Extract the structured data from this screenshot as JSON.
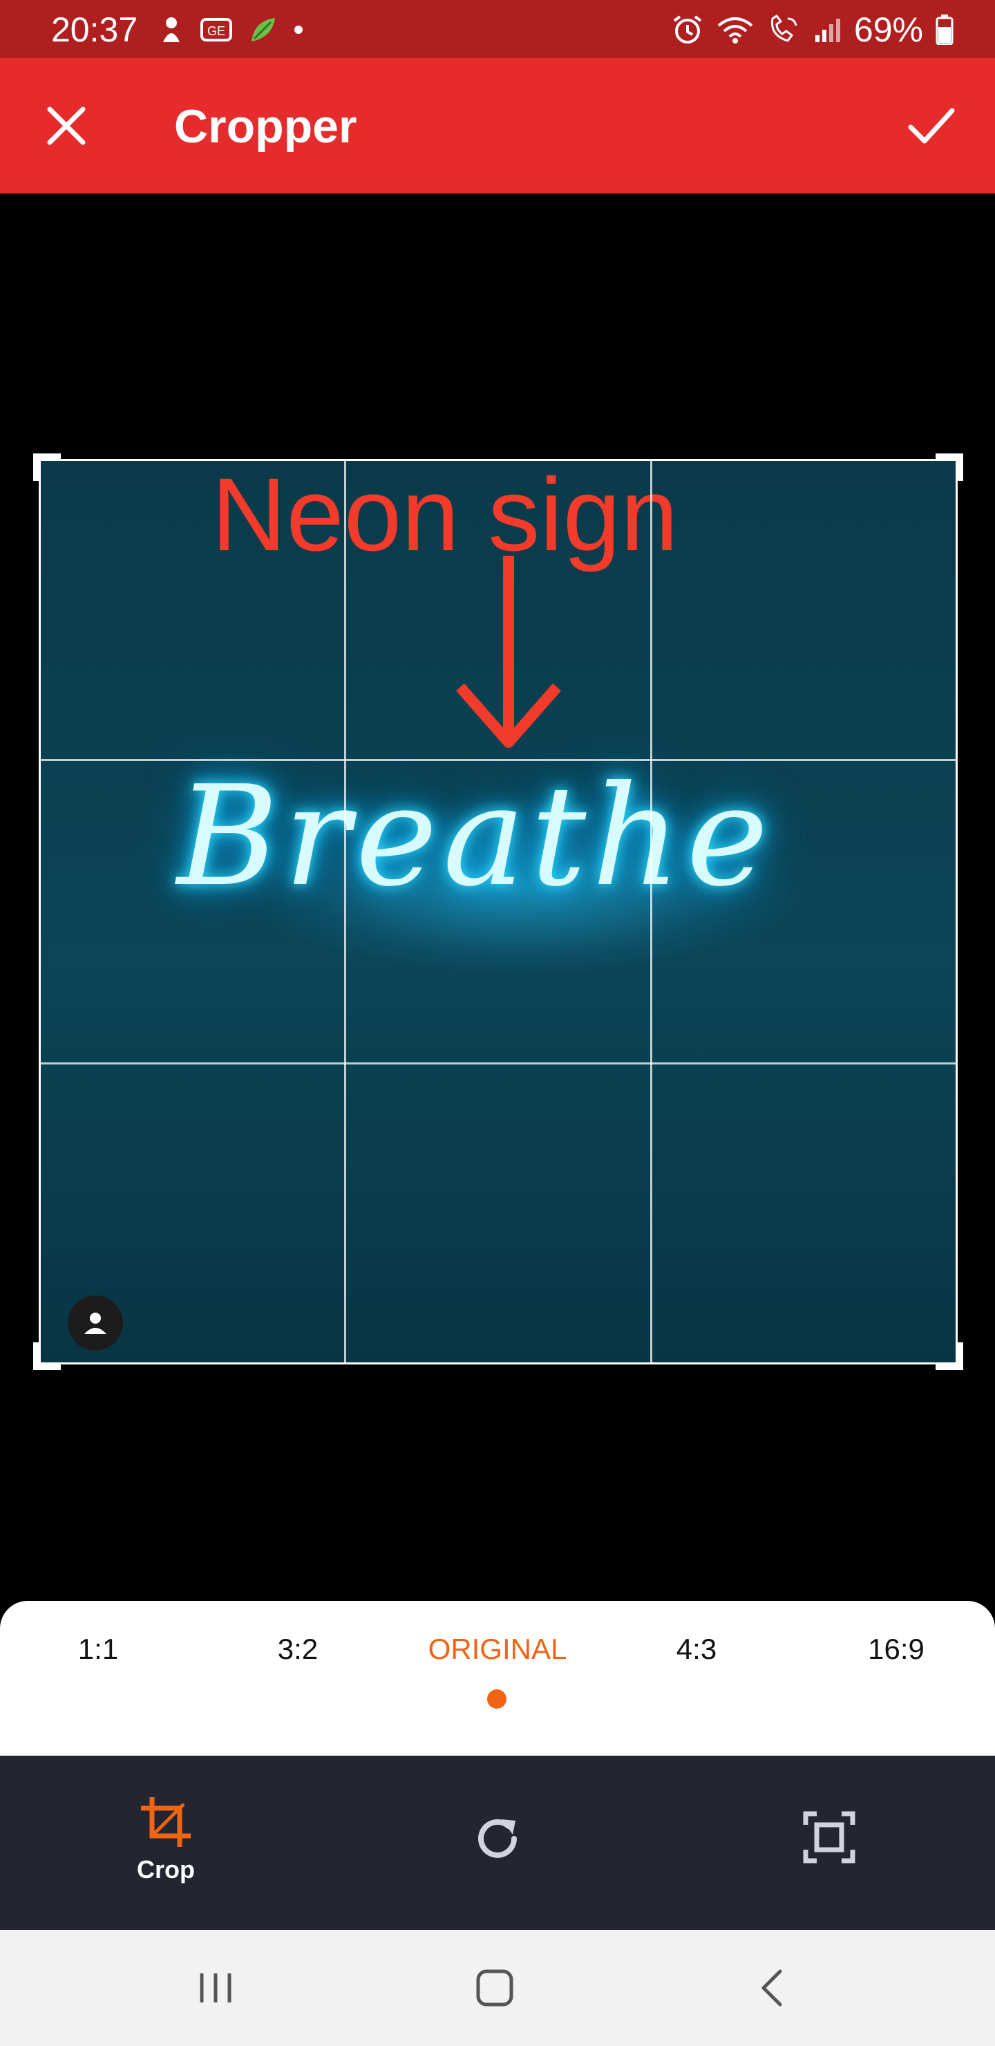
{
  "status_bar": {
    "time": "20:37",
    "battery": "69%",
    "icons": [
      "pill-icon",
      "game-icon",
      "leaf-icon",
      "alarm-icon",
      "wifi-icon",
      "wifi-calling-icon",
      "signal-icon",
      "battery-icon"
    ]
  },
  "app_bar": {
    "title": "Cropper",
    "close_icon": "close-icon",
    "confirm_icon": "check-icon"
  },
  "image": {
    "overlay_label": "Neon sign",
    "neon_word": "Breathe"
  },
  "aspect_ratios": {
    "options": [
      "1:1",
      "3:2",
      "ORIGINAL",
      "4:3",
      "16:9"
    ],
    "selected": "ORIGINAL"
  },
  "toolbar": {
    "crop_label": "Crop",
    "tools": [
      "crop-icon",
      "rotate-icon",
      "fit-icon"
    ]
  },
  "colors": {
    "status_bar": "#b01f1f",
    "app_bar": "#e52b2b",
    "accent": "#f06414",
    "toolbar_bg": "#232631"
  }
}
